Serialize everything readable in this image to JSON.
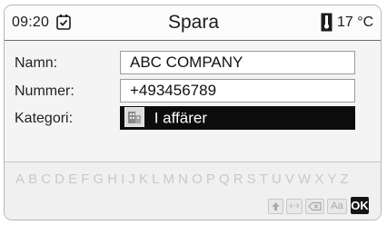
{
  "status_bar": {
    "time": "09:20",
    "reminder_icon": "clock-check-icon",
    "title": "Spara",
    "thermometer_icon": "thermometer-icon",
    "temperature": "17 °C"
  },
  "form": {
    "name_label": "Namn:",
    "name_value": "ABC COMPANY",
    "number_label": "Nummer:",
    "number_value": "+493456789",
    "category_label": "Kategori:",
    "category_icon": "office-building-icon",
    "category_value": "I affärer"
  },
  "keyboard": {
    "alphabet": "ABCDEFGHIJKLMNOPQRSTUVWXYZ",
    "shift_icon": "shift-arrow-icon",
    "switch_label": "‹·›",
    "backspace_icon": "backspace-icon",
    "case_label": "Aa",
    "ok_label": "OK"
  },
  "colors": {
    "selection_background": "#0c0c0c",
    "disabled_text": "#c9c9c9"
  }
}
